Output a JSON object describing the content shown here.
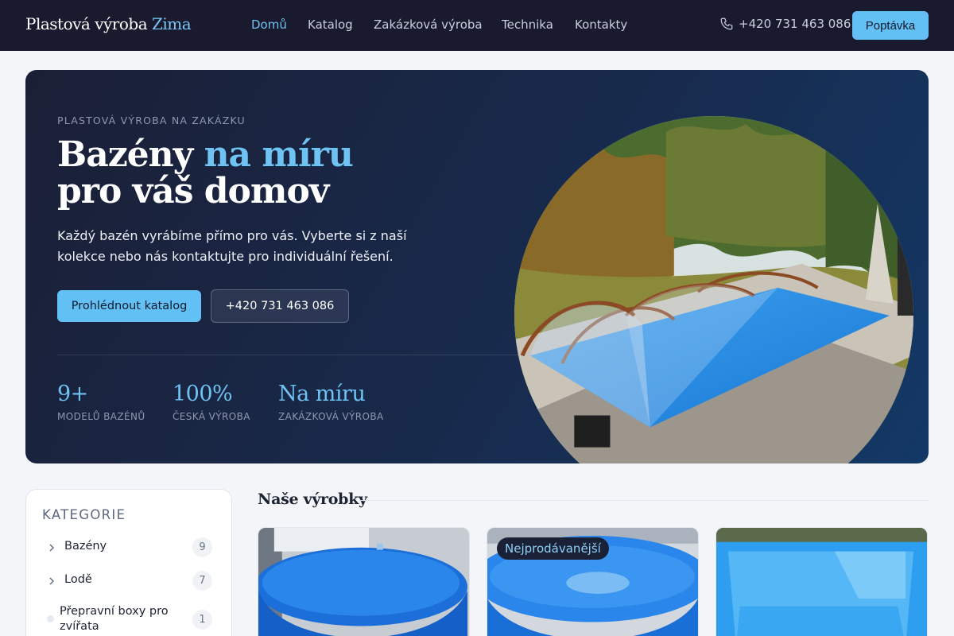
{
  "nav": {
    "brand_main": "Plastová výroba",
    "brand_accent": "Zima",
    "items": [
      {
        "label": "Domů",
        "active": true
      },
      {
        "label": "Katalog",
        "active": false
      },
      {
        "label": "Zakázková výroba",
        "active": false
      },
      {
        "label": "Technika",
        "active": false
      },
      {
        "label": "Kontakty",
        "active": false
      }
    ],
    "phone": "+420 731 463 086",
    "phone_icon": "phone-icon",
    "cta_label": "Poptávka"
  },
  "hero": {
    "eyebrow": "PLASTOVÁ VÝROBA NA ZAKÁZKU",
    "headline_part1": "Bazény ",
    "headline_accent": "na míru",
    "headline_line2": "pro váš domov",
    "lead": "Každý bazén vyrábíme přímo pro vás. Vyberte si z naší kolekce nebo nás kontaktujte pro individuální řešení.",
    "primary_button": "Prohlédnout katalog",
    "secondary_button": "+420 731 463 086",
    "stats": [
      {
        "value": "9+",
        "label": "MODELŮ BAZÉNŮ"
      },
      {
        "value": "100%",
        "label": "ČESKÁ VÝROBA"
      },
      {
        "value": "Na míru",
        "label": "ZAKÁZKOVÁ VÝROBA"
      }
    ]
  },
  "sidebar": {
    "title": "KATEGORIE",
    "categories": [
      {
        "label": "Bazény",
        "count": "9",
        "icon": "chevron-right-icon"
      },
      {
        "label": "Lodě",
        "count": "7",
        "icon": "chevron-right-icon"
      },
      {
        "label": "Přepravní boxy pro zvířata",
        "count": "1",
        "icon": "dot-icon"
      }
    ]
  },
  "products": {
    "title": "Naše výrobky",
    "badge": "Nejprodávanější"
  },
  "colors": {
    "nav_bg": "#1a1a2e",
    "accent": "#63c0f5",
    "accent_text": "#6fc3f3",
    "hero_bg_start": "#1b1f36",
    "hero_bg_end": "#133866",
    "page_bg": "#f3f5f9"
  }
}
